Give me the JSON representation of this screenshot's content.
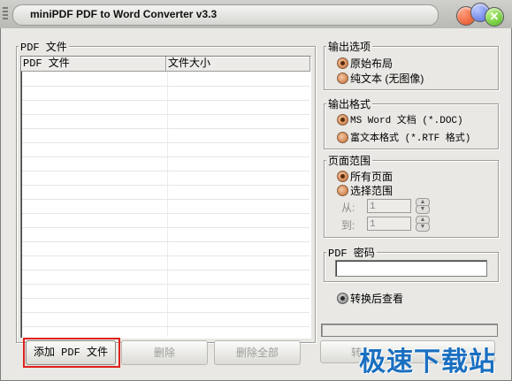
{
  "window": {
    "title": "miniPDF PDF to Word Converter v3.3"
  },
  "files": {
    "group_title": "PDF 文件",
    "columns": [
      "PDF 文件",
      "文件大小"
    ],
    "rows": []
  },
  "buttons": {
    "add": "添加 PDF 文件",
    "delete": "删除",
    "delete_all": "删除全部",
    "convert": "转"
  },
  "output_options": {
    "title": "输出选项",
    "items": [
      "原始布局",
      "纯文本 (无图像)"
    ],
    "selected": 0
  },
  "output_format": {
    "title": "输出格式",
    "items": [
      "MS Word 文档 (*.DOC)",
      "富文本格式 (*.RTF 格式)"
    ],
    "selected": 0
  },
  "page_range": {
    "title": "页面范围",
    "items": [
      "所有页面",
      "选择范围"
    ],
    "selected": 0,
    "from_label": "从:",
    "from_value": "1",
    "to_label": "到:",
    "to_value": "1"
  },
  "password": {
    "title": "PDF 密码",
    "value": ""
  },
  "view_after": {
    "label": "转换后查看",
    "checked": true
  },
  "progress": {
    "value": 0
  },
  "watermark": {
    "text": "极速下载站"
  }
}
